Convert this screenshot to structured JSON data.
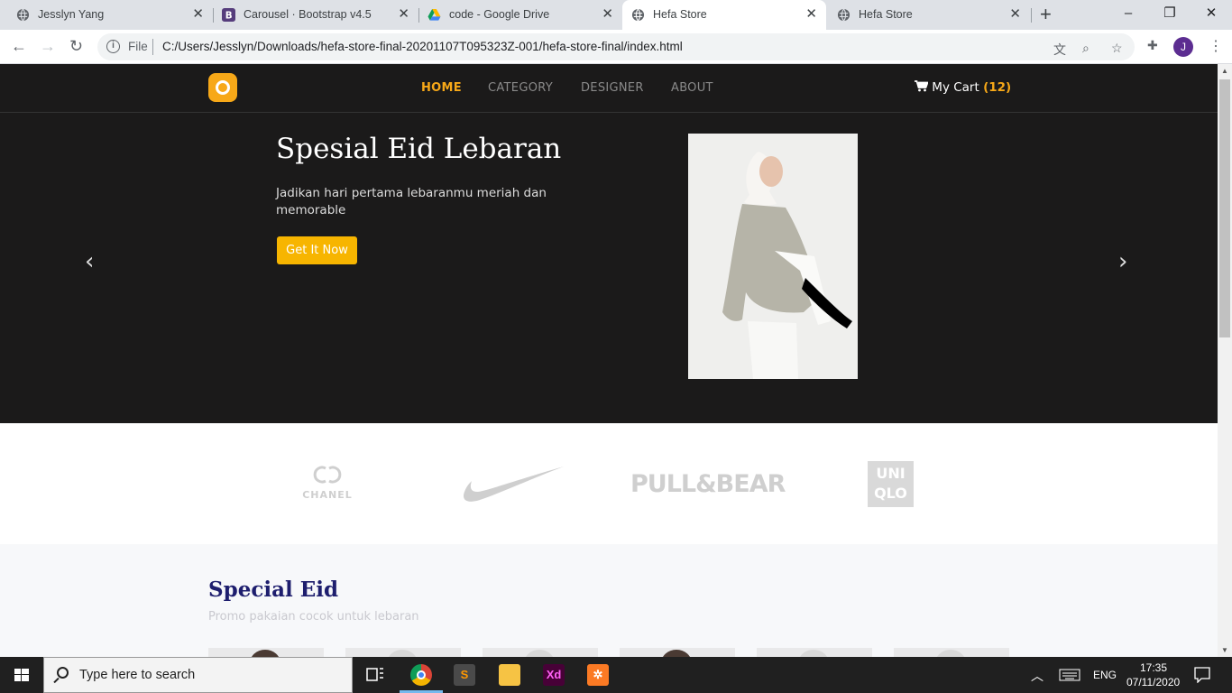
{
  "browser": {
    "tabs": [
      {
        "title": "Jesslyn Yang",
        "favicon": "globe-icon"
      },
      {
        "title": "Carousel · Bootstrap v4.5",
        "favicon": "bootstrap-icon"
      },
      {
        "title": "code - Google Drive",
        "favicon": "google-drive-icon"
      },
      {
        "title": "Hefa Store",
        "favicon": "globe-icon",
        "active": true
      },
      {
        "title": "Hefa Store",
        "favicon": "globe-icon"
      }
    ],
    "new_tab": "+",
    "window_controls": {
      "minimize": "–",
      "maximize": "❐",
      "close": "✕"
    },
    "address": {
      "scheme_label": "File",
      "url": "C:/Users/Jesslyn/Downloads/hefa-store-final-20201107T095323Z-001/hefa-store-final/index.html"
    },
    "profile_initial": "J"
  },
  "site": {
    "nav": {
      "items": [
        {
          "label": "HOME",
          "active": true
        },
        {
          "label": "CATEGORY"
        },
        {
          "label": "DESIGNER"
        },
        {
          "label": "ABOUT"
        }
      ],
      "cart_label": "My Cart",
      "cart_count": "(12)"
    },
    "hero": {
      "title": "Spesial Eid Lebaran",
      "description": "Jadikan hari pertama lebaranmu meriah dan memorable",
      "button": "Get It Now",
      "prev": "‹",
      "next": "›"
    },
    "brands": [
      "CHANEL",
      "PULL&BEAR",
      "UNI",
      "QLO"
    ],
    "special": {
      "title": "Special Eid",
      "subtitle": "Promo pakaian cocok untuk lebaran"
    }
  },
  "taskbar": {
    "search_placeholder": "Type here to search",
    "language": "ENG",
    "time": "17:35",
    "date": "07/11/2020"
  },
  "colors": {
    "brand_accent": "#f7a818",
    "nav_bg": "#1b1a1a",
    "heading": "#1e1e6e"
  }
}
